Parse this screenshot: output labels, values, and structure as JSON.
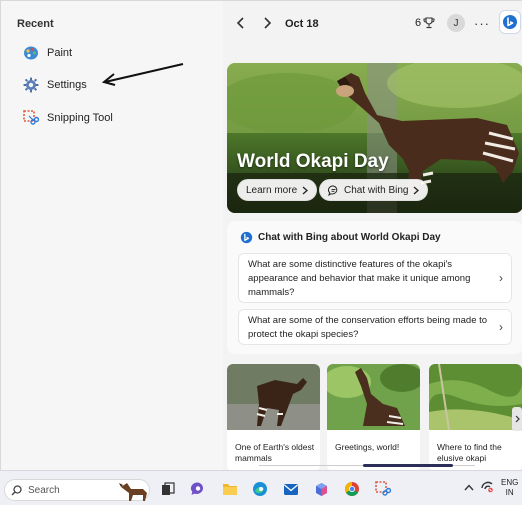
{
  "left_panel": {
    "title": "Recent",
    "items": [
      {
        "label": "Paint",
        "icon": "paint-icon"
      },
      {
        "label": "Settings",
        "icon": "gear-icon"
      },
      {
        "label": "Snipping Tool",
        "icon": "snipping-tool-icon"
      }
    ]
  },
  "topbar": {
    "date": "Oct 18",
    "reward_count": "6",
    "avatar_initial": "J",
    "more_label": "···"
  },
  "hero": {
    "title": "World Okapi Day",
    "learn_more_label": "Learn more",
    "chat_label": "Chat with Bing"
  },
  "chat_card": {
    "header": "Chat with Bing about World Okapi Day",
    "questions": [
      "What are some distinctive features of the okapi's appearance and behavior that make it unique among mammals?",
      "What are some of the conservation efforts being made to protect the okapi species?"
    ]
  },
  "thumbnails": [
    {
      "caption": "One of Earth's oldest mammals"
    },
    {
      "caption": "Greetings, world!"
    },
    {
      "caption": "Where to find the elusive okapi"
    }
  ],
  "carousel": {
    "position": 0.55
  },
  "taskbar": {
    "search_placeholder": "Search",
    "apps": [
      "task-view-icon",
      "chat-icon",
      "file-explorer-icon",
      "edge-icon",
      "mail-icon",
      "store-icon",
      "chrome-icon",
      "snipping-tool-icon"
    ],
    "lang_top": "ENG",
    "lang_bottom": "IN"
  },
  "colors": {
    "accent": "#1f6fd1",
    "hero_green": "#4f7a2a",
    "progress": "#2d2d5a"
  }
}
